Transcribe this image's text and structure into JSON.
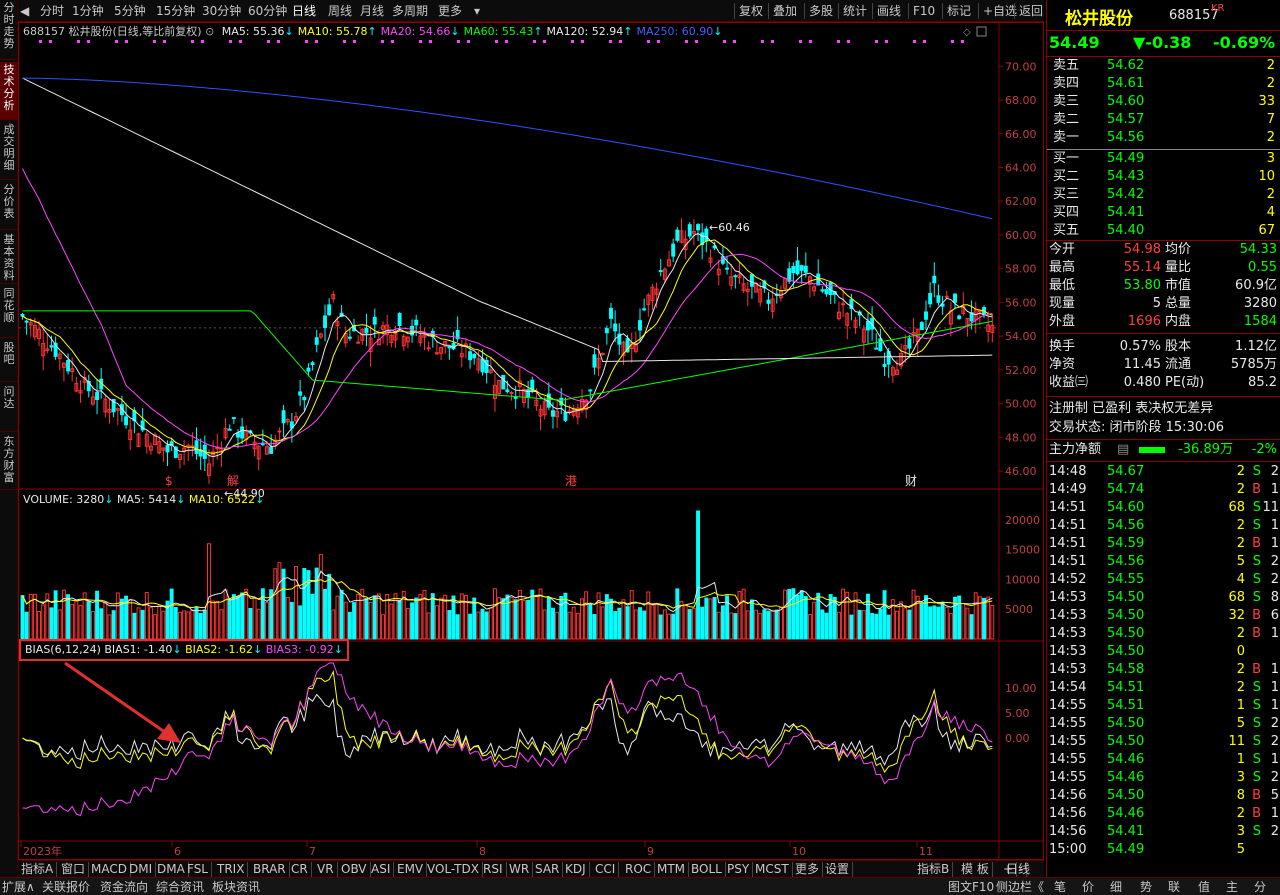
{
  "vtabs": [
    "分时走势",
    "技术分析",
    "成交明细",
    "分价表",
    "基本资料",
    "同花顺",
    "股吧",
    "问达",
    "东方财富"
  ],
  "toolbar": {
    "periods": [
      "分时",
      "1分钟",
      "5分钟",
      "15分钟",
      "30分钟",
      "60分钟",
      "日线",
      "周线",
      "月线",
      "多周期",
      "更多"
    ],
    "active": "日线",
    "right": [
      "复权",
      "叠加",
      "多股",
      "统计",
      "画线",
      "F10",
      "标记",
      "+自选",
      "返回"
    ]
  },
  "ma_info": {
    "title": "688157 松井股份(日线,等比前复权)",
    "items": [
      {
        "label": "MA5: 55.36",
        "arrow": "↓",
        "color": "#e8e8e8"
      },
      {
        "label": "MA10: 55.78",
        "arrow": "↑",
        "color": "#ffff00"
      },
      {
        "label": "MA20: 54.66",
        "arrow": "↓",
        "color": "#ff44ff"
      },
      {
        "label": "MA60: 55.43",
        "arrow": "↑",
        "color": "#00ff00"
      },
      {
        "label": "MA120: 52.94",
        "arrow": "↑",
        "color": "#e8e8e8"
      },
      {
        "label": "MA250: 60.90",
        "arrow": "↓",
        "color": "#4060ff"
      }
    ]
  },
  "vol_info": {
    "label": "VOLUME: 3280",
    "ma5": "MA5: 5414",
    "ma10": "MA10: 6522"
  },
  "bias_info": {
    "label": "BIAS(6,12,24)",
    "b1": "BIAS1: -1.40",
    "b2": "BIAS2: -1.62",
    "b3": "BIAS3: -0.92"
  },
  "price_axis": [
    "70.00",
    "68.00",
    "66.00",
    "64.00",
    "62.00",
    "60.00",
    "58.00",
    "56.00",
    "54.00",
    "52.00",
    "50.00",
    "48.00",
    "46.00"
  ],
  "vol_axis": [
    "20000",
    "15000",
    "10000",
    "5000"
  ],
  "bias_axis": [
    "10.00",
    "5.00",
    "0.00"
  ],
  "date_axis": [
    "2023年",
    "6",
    "7",
    "8",
    "9",
    "10",
    "11"
  ],
  "annotations": {
    "high": "60.46",
    "low": "44.90",
    "marks": [
      "$",
      "解",
      "港",
      "财"
    ]
  },
  "bottom_tabs": [
    "指标A",
    "窗口",
    "MACD",
    "DMI",
    "DMA",
    "FSL",
    "TRIX",
    "BRAR",
    "CR",
    "VR",
    "OBV",
    "ASI",
    "EMV",
    "VOL-TDX",
    "RSI",
    "WR",
    "SAR",
    "KDJ",
    "CCI",
    "ROC",
    "MTM",
    "BOLL",
    "PSY",
    "MCST",
    "更多",
    "设置"
  ],
  "bottom_right": [
    "指标B",
    "模 板",
    "+",
    "-"
  ],
  "period_label": "日线",
  "footer_left": [
    "扩展∧",
    "关联报价",
    "资金流向",
    "综合资讯",
    "板块资讯"
  ],
  "footer_right": [
    "图文F10",
    "侧边栏《",
    "笔",
    "价",
    "细",
    "势",
    "联",
    "值",
    "主",
    "分"
  ],
  "quote": {
    "name": "松井股份",
    "code": "688157",
    "tag": "KR",
    "price": "54.49",
    "change": "▼-0.38",
    "pct": "-0.69%",
    "sell": [
      {
        "l": "卖五",
        "p": "54.62",
        "v": "2"
      },
      {
        "l": "卖四",
        "p": "54.61",
        "v": "2"
      },
      {
        "l": "卖三",
        "p": "54.60",
        "v": "33"
      },
      {
        "l": "卖二",
        "p": "54.57",
        "v": "7"
      },
      {
        "l": "卖一",
        "p": "54.56",
        "v": "2"
      }
    ],
    "buy": [
      {
        "l": "买一",
        "p": "54.49",
        "v": "3"
      },
      {
        "l": "买二",
        "p": "54.43",
        "v": "10"
      },
      {
        "l": "买三",
        "p": "54.42",
        "v": "2"
      },
      {
        "l": "买四",
        "p": "54.41",
        "v": "4"
      },
      {
        "l": "买五",
        "p": "54.40",
        "v": "67"
      }
    ],
    "stats": [
      [
        {
          "l": "今开",
          "v": "54.98",
          "c": "red"
        },
        {
          "l": "均价",
          "v": "54.33",
          "c": "green"
        }
      ],
      [
        {
          "l": "最高",
          "v": "55.14",
          "c": "red"
        },
        {
          "l": "量比",
          "v": "0.55",
          "c": "green"
        }
      ],
      [
        {
          "l": "最低",
          "v": "53.80",
          "c": "green"
        },
        {
          "l": "市值",
          "v": "60.9亿",
          "c": "white"
        }
      ],
      [
        {
          "l": "现量",
          "v": "5",
          "c": "white"
        },
        {
          "l": "总量",
          "v": "3280",
          "c": "white"
        }
      ],
      [
        {
          "l": "外盘",
          "v": "1696",
          "c": "red"
        },
        {
          "l": "内盘",
          "v": "1584",
          "c": "green"
        }
      ]
    ],
    "stats2": [
      [
        {
          "l": "换手",
          "v": "0.57%",
          "c": "white"
        },
        {
          "l": "股本",
          "v": "1.12亿",
          "c": "white"
        }
      ],
      [
        {
          "l": "净资",
          "v": "11.45",
          "c": "white"
        },
        {
          "l": "流通",
          "v": "5785万",
          "c": "white"
        }
      ],
      [
        {
          "l": "收益㈢",
          "v": "0.480",
          "c": "white"
        },
        {
          "l": "PE(动)",
          "v": "85.2",
          "c": "white"
        }
      ]
    ],
    "reg": "注册制 已盈利 表决权无差异",
    "trade_status": "交易状态: 闭市阶段 15:30:06",
    "main_flow": {
      "label": "主力净额",
      "value": "-36.89万",
      "pct": "-2%"
    },
    "ticks": [
      [
        "14:48",
        "54.67",
        "2",
        "S",
        "2"
      ],
      [
        "14:49",
        "54.74",
        "2",
        "B",
        "1"
      ],
      [
        "14:51",
        "54.60",
        "68",
        "S",
        "11"
      ],
      [
        "14:51",
        "54.56",
        "2",
        "S",
        "1"
      ],
      [
        "14:51",
        "54.59",
        "2",
        "B",
        "1"
      ],
      [
        "14:51",
        "54.56",
        "5",
        "S",
        "2"
      ],
      [
        "14:52",
        "54.55",
        "4",
        "S",
        "2"
      ],
      [
        "14:53",
        "54.50",
        "68",
        "S",
        "8"
      ],
      [
        "14:53",
        "54.50",
        "32",
        "B",
        "6"
      ],
      [
        "14:53",
        "54.50",
        "2",
        "B",
        "1"
      ],
      [
        "14:53",
        "54.50",
        "0",
        "",
        ""
      ],
      [
        "14:53",
        "54.58",
        "2",
        "B",
        "1"
      ],
      [
        "14:54",
        "54.51",
        "2",
        "S",
        "1"
      ],
      [
        "14:55",
        "54.51",
        "1",
        "S",
        "1"
      ],
      [
        "14:55",
        "54.50",
        "5",
        "S",
        "2"
      ],
      [
        "14:55",
        "54.50",
        "11",
        "S",
        "2"
      ],
      [
        "14:55",
        "54.46",
        "1",
        "S",
        "1"
      ],
      [
        "14:55",
        "54.46",
        "3",
        "S",
        "2"
      ],
      [
        "14:56",
        "54.50",
        "8",
        "B",
        "5"
      ],
      [
        "14:56",
        "54.46",
        "2",
        "B",
        "1"
      ],
      [
        "14:56",
        "54.41",
        "3",
        "S",
        "2"
      ],
      [
        "15:00",
        "54.49",
        "5",
        "",
        ""
      ]
    ]
  },
  "colors": {
    "up": "#ff3232",
    "down": "#00ffff",
    "ma5": "#e8e8e8",
    "ma10": "#ffff00",
    "ma20": "#ff44ff",
    "ma60": "#00ff00",
    "ma120": "#e8e8e8",
    "ma250": "#3050ff",
    "accent": "#8b0000"
  }
}
